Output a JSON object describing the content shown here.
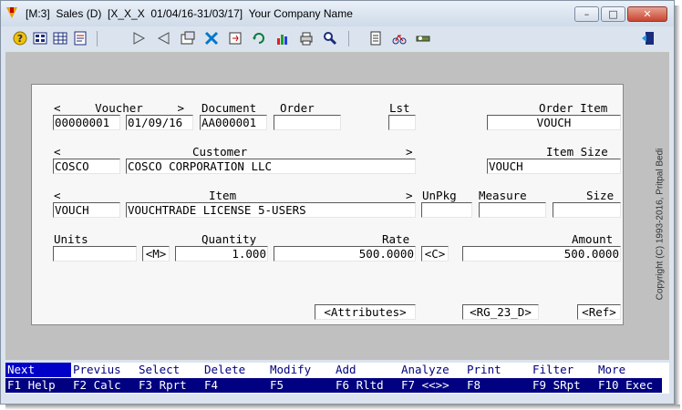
{
  "window": {
    "title": "[M:3]  Sales (D)  [X_X_X  01/04/16-31/03/17]  Your Company Name",
    "minimize_glyph": "–",
    "maximize_glyph": "□",
    "close_glyph": "✕"
  },
  "toolbar": {
    "icons": [
      "help-icon",
      "grid-icon",
      "table-icon",
      "report-icon",
      "next-icon",
      "previous-icon",
      "properties-icon",
      "tools-icon",
      "export-icon",
      "refresh-icon",
      "chart-icon",
      "print-icon",
      "zoom-icon",
      "notes-icon",
      "bicycle-icon",
      "settings-icon",
      "exit-icon"
    ]
  },
  "form": {
    "voucher_header": "<     Voucher     >",
    "document_header": "Document",
    "order_header": "Order",
    "lst_header": "Lst",
    "order_item_header": "Order Item",
    "voucher_no": "00000001",
    "voucher_date": "01/09/16",
    "document": "AA000001",
    "order": "",
    "lst": "",
    "order_item": "VOUCH",
    "customer_lt": "<",
    "customer_header": "Customer",
    "customer_gt": ">",
    "item_size_header": "Item Size",
    "customer_code": "COSCO",
    "customer_name": "COSCO CORPORATION LLC",
    "item_size": "VOUCH",
    "item_lt": "<",
    "item_header": "Item",
    "item_gt": ">",
    "unpkg_header": "UnPkg",
    "measure_header": "Measure",
    "size_header": "Size",
    "item_code": "VOUCH",
    "item_name": "VOUCHTRADE LICENSE 5-USERS",
    "unpkg": "",
    "measure": "",
    "size": "",
    "units_header": "Units",
    "quantity_header": "Quantity",
    "rate_header": "Rate",
    "amount_header": "Amount",
    "units": "",
    "m_button": "<M>",
    "quantity": "1.000",
    "rate": "500.0000",
    "c_button": "<C>",
    "amount": "500.0000",
    "attributes_button": "<Attributes>",
    "rg23d_button": "<RG_23_D>",
    "ref_button": "<Ref>"
  },
  "copyright": "Copyright (C) 1993-2016, Pritpal Bedi",
  "fkeys": [
    {
      "top": "Next",
      "bottom": "F1 Help",
      "active": true
    },
    {
      "top": "Previus",
      "bottom": "F2 Calc"
    },
    {
      "top": "Select",
      "bottom": "F3 Rprt"
    },
    {
      "top": "Delete",
      "bottom": "F4"
    },
    {
      "top": "Modify",
      "bottom": "F5"
    },
    {
      "top": "Add",
      "bottom": "F6 Rltd"
    },
    {
      "top": "Analyze",
      "bottom": "F7 <<>>"
    },
    {
      "top": "Print",
      "bottom": "F8"
    },
    {
      "top": "Filter",
      "bottom": "F9 SRpt"
    },
    {
      "top": "More",
      "bottom": "F10 Exec"
    }
  ]
}
